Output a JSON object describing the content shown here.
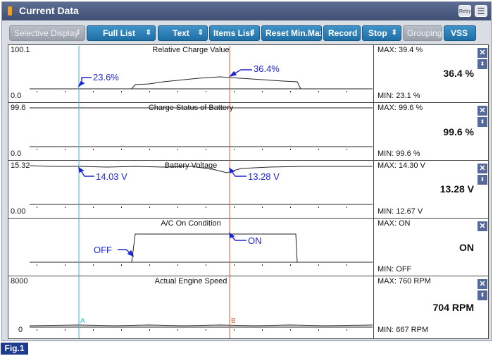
{
  "window": {
    "title": "Current Data",
    "right_icons": [
      {
        "name": "retry",
        "label": "Retry"
      },
      {
        "name": "menu",
        "label": ""
      }
    ]
  },
  "toolbar": {
    "buttons": [
      {
        "label": "Selective Display",
        "has_dropdown": true,
        "enabled": false
      },
      {
        "label": "Full List",
        "has_dropdown": true,
        "enabled": true
      },
      {
        "label": "Text",
        "has_dropdown": true,
        "enabled": true
      },
      {
        "label": "Items List",
        "has_dropdown": true,
        "enabled": true
      },
      {
        "label": "Reset Min.Max",
        "has_dropdown": false,
        "enabled": true
      },
      {
        "label": "Record",
        "has_dropdown": false,
        "enabled": true
      },
      {
        "label": "Stop",
        "has_dropdown": true,
        "enabled": true
      },
      {
        "label": "Grouping",
        "has_dropdown": false,
        "enabled": false
      },
      {
        "label": "VSS",
        "has_dropdown": false,
        "enabled": true
      }
    ]
  },
  "cursors": {
    "a": "A",
    "b": "B",
    "a_color": "#33c0c0",
    "b_color": "#e05a30"
  },
  "graphs": [
    {
      "title": "Relative Charge Value",
      "ymax": "100.1",
      "ymin": "0.0",
      "max": "MAX:  39.4 %",
      "min": "MIN:  23.1 %",
      "current": "36.4 %",
      "annotations": [
        "23.6%",
        "36.4%"
      ],
      "has_scroll": true
    },
    {
      "title": "Charge Status of Battery",
      "ymax": "99.6",
      "ymin": "0.0",
      "max": "MAX:  99.6 %",
      "min": "MIN:  99.6 %",
      "current": "99.6 %",
      "annotations": [],
      "has_scroll": true
    },
    {
      "title": "Battery Voltage",
      "ymax": "15.32",
      "ymin": "0.00",
      "max": "MAX: 14.30 V",
      "min": "MIN: 12.67 V",
      "current": "13.28 V",
      "annotations": [
        "14.03 V",
        "13.28 V"
      ],
      "has_scroll": true
    },
    {
      "title": "A/C On Condition",
      "ymax": "",
      "ymin": "",
      "max": "MAX: ON",
      "min": "MIN: OFF",
      "current": "ON",
      "annotations": [
        "OFF",
        "ON"
      ],
      "has_scroll": false
    },
    {
      "title": "Actual Engine Speed",
      "ymax": "8000",
      "ymin": "0",
      "max": "MAX:    760 RPM",
      "min": "MIN:    667 RPM",
      "current": "704 RPM",
      "annotations": [],
      "has_scroll": true
    }
  ],
  "figure_label": "Fig.1",
  "colors": {
    "annotation": "#1d24d6",
    "button": "#2a7fb8",
    "title_bar": "#4a5a80"
  },
  "icons": {
    "close": "close-icon",
    "scroll": "scroll-icon",
    "retry": "retry-icon",
    "menu": "menu-icon"
  }
}
